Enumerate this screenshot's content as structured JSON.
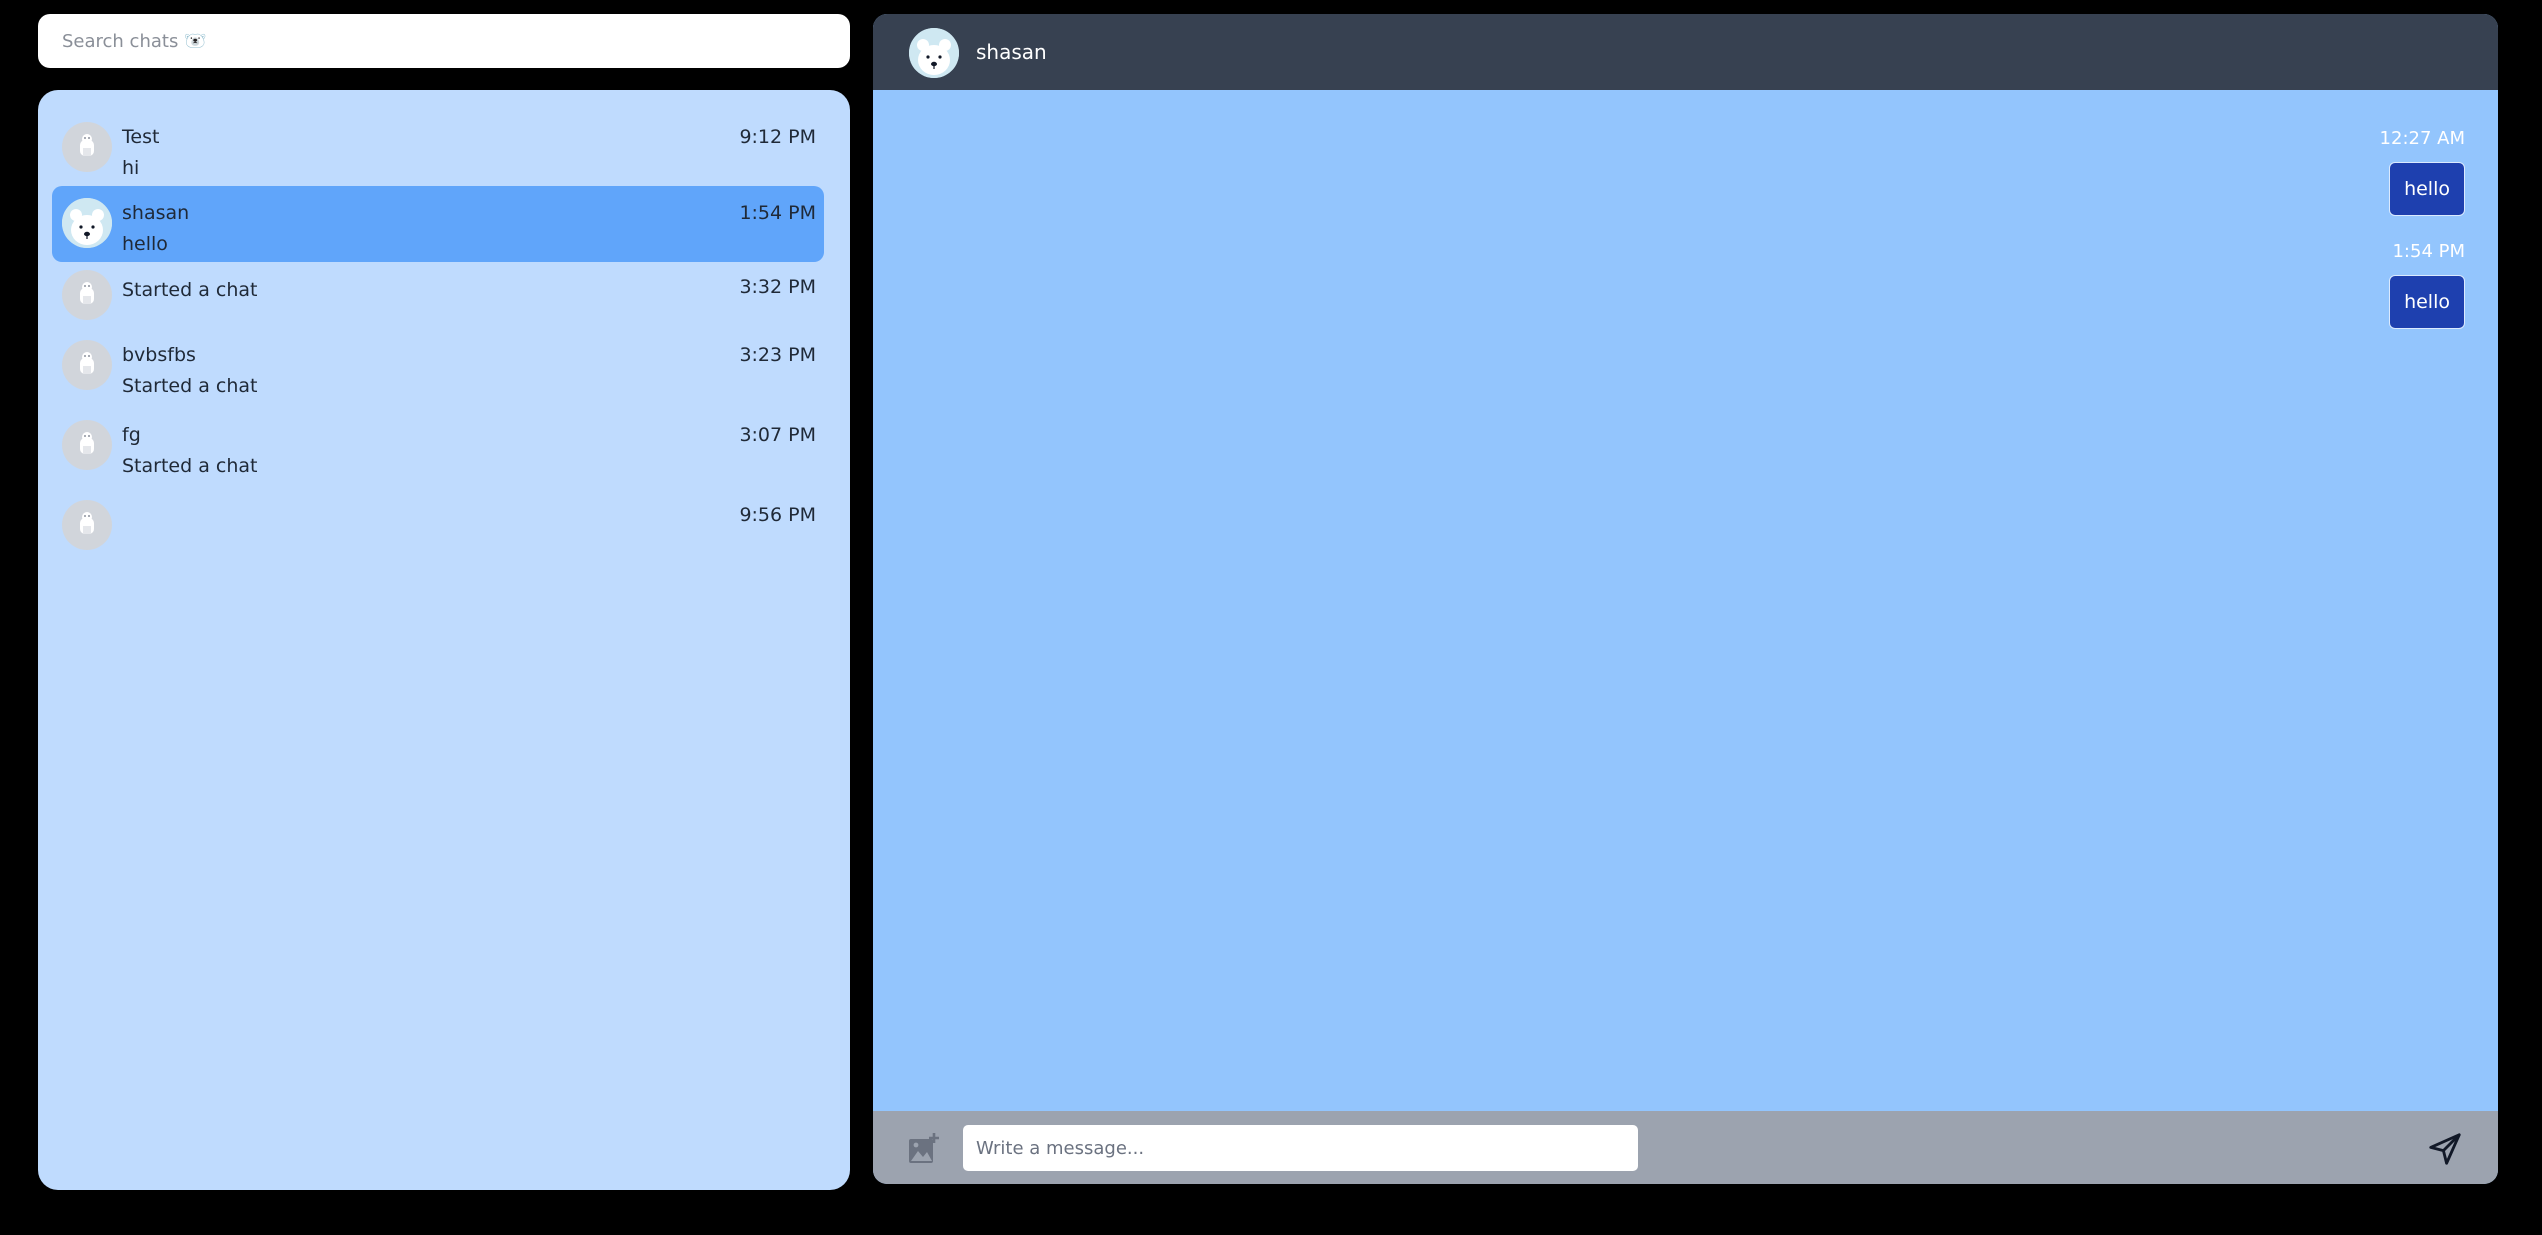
{
  "search": {
    "placeholder": "Search chats 🐻‍❄️"
  },
  "chats": [
    {
      "name": "Test",
      "preview": "hi",
      "time": "9:12 PM",
      "avatar": "polar-bear-grey-icon",
      "active": false
    },
    {
      "name": "shasan",
      "preview": "hello",
      "time": "1:54 PM",
      "avatar": "polar-bear-face-icon",
      "active": true
    },
    {
      "name": "",
      "preview": "Started a chat",
      "time": "3:32 PM",
      "avatar": "polar-bear-grey-icon",
      "active": false
    },
    {
      "name": "bvbsfbs",
      "preview": "Started a chat",
      "time": "3:23 PM",
      "avatar": "polar-bear-grey-icon",
      "active": false
    },
    {
      "name": "fg",
      "preview": "Started a chat",
      "time": "3:07 PM",
      "avatar": "polar-bear-grey-icon",
      "active": false
    },
    {
      "name": "",
      "preview": "",
      "time": "9:56 PM",
      "avatar": "polar-bear-grey-icon",
      "active": false
    }
  ],
  "header": {
    "title": "shasan"
  },
  "messages": [
    {
      "time": "12:27 AM",
      "text": "hello"
    },
    {
      "time": "1:54 PM",
      "text": "hello"
    }
  ],
  "composer": {
    "placeholder": "Write a message...",
    "image_icon": "add-image-icon",
    "send_icon": "send-icon"
  },
  "colors": {
    "background": "#000000",
    "sidebar": "#bfdbfe",
    "active_chat": "#60a5fa",
    "chat_area": "#93c5fd",
    "header": "#374151",
    "composer": "#9ca3af",
    "bubble": "#1e40af"
  }
}
